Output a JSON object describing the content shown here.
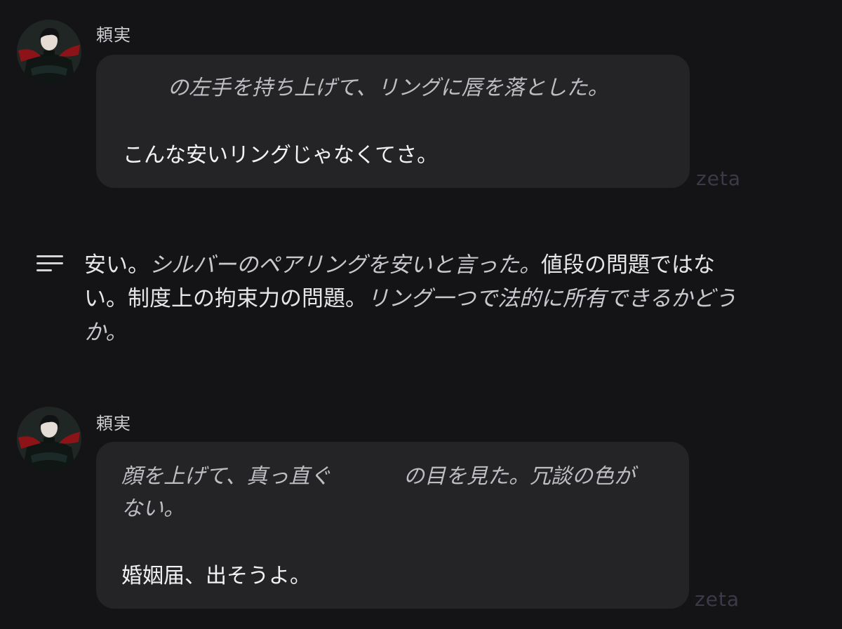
{
  "messages": [
    {
      "author": "頼実",
      "avatar": "character-avatar",
      "lines": [
        {
          "text": "の左手を持ち上げて、リングに唇を落とした。",
          "style": "action"
        },
        {
          "text": "こんな安いリングじゃなくてさ。",
          "style": "speech"
        }
      ],
      "watermark": "zeta"
    },
    {
      "author": "頼実",
      "avatar": "character-avatar",
      "lines": [
        {
          "text": "顔を上げて、真っ直ぐ",
          "style": "action"
        },
        {
          "text": "の目を見た。冗談の色が",
          "style": "action"
        },
        {
          "text": "ない。",
          "style": "action"
        },
        {
          "text": "婚姻届、出そうよ。",
          "style": "speech"
        }
      ],
      "watermark": "zeta"
    }
  ],
  "narration": {
    "icon": "narration-lines-icon",
    "line1_plain": "安い。",
    "line1_italic": "シルバーのペアリングを安いと言った。",
    "line1_plain2": "値段の問題ではな",
    "line2_plain": "い。制度上の拘束力の問題。",
    "line2_italic": "リング一つで法的に所有できるかどう",
    "line3_italic": "か。"
  },
  "colors": {
    "background": "#141316",
    "bubble": "#242326",
    "watermark": "#3c3a48"
  }
}
